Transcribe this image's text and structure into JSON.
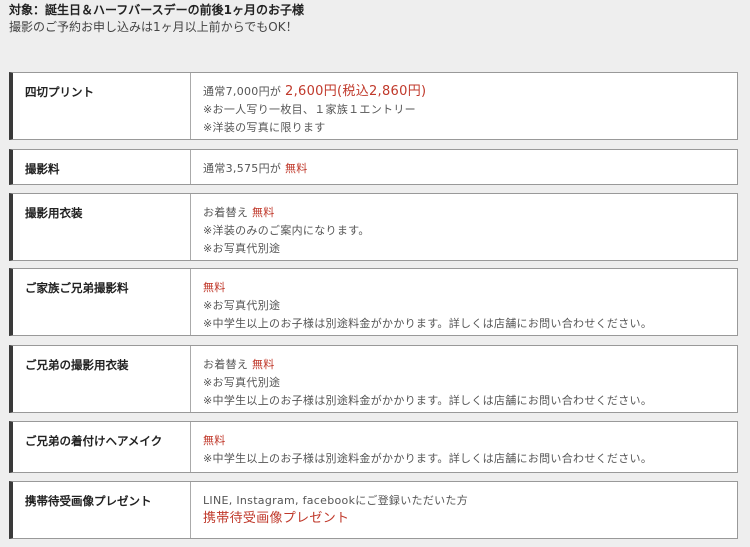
{
  "header": {
    "target": "対象：誕生日＆ハーフバースデーの前後1ヶ月のお子様",
    "note": "撮影のご予約お申し込みは1ヶ月以上前からでもOK！"
  },
  "rows": [
    {
      "label": "四切プリント",
      "line1_pre": "通常7,000円が",
      "line1_red": "2,600円(税込2,860円)",
      "line2": "※お一人写り一枚目、１家族１エントリー",
      "line3": "※洋装の写真に限ります"
    },
    {
      "label": "撮影料",
      "line1_pre": "通常3,575円が",
      "line1_red": "無料"
    },
    {
      "label": "撮影用衣装",
      "line1_pre": "お着替え",
      "line1_red": "無料",
      "line2": "※洋装のみのご案内になります。",
      "line3": "※お写真代別途"
    },
    {
      "label": "ご家族ご兄弟撮影料",
      "line1_red": "無料",
      "line2": "※お写真代別途",
      "line3": "※中学生以上のお子様は別途料金がかかります。詳しくは店舗にお問い合わせください。"
    },
    {
      "label": "ご兄弟の撮影用衣装",
      "line1_pre": "お着替え",
      "line1_red": "無料",
      "line2": "※お写真代別途",
      "line3": "※中学生以上のお子様は別途料金がかかります。詳しくは店舗にお問い合わせください。"
    },
    {
      "label": "ご兄弟の着付けヘアメイク",
      "line1_red": "無料",
      "line2": "※中学生以上のお子様は別途料金がかかります。詳しくは店舗にお問い合わせください。"
    },
    {
      "label": "携帯待受画像プレゼント",
      "line1_pre": "LINE, Instagram, facebookにご登録いただいた方",
      "line2_red": "携帯待受画像プレゼント"
    }
  ]
}
